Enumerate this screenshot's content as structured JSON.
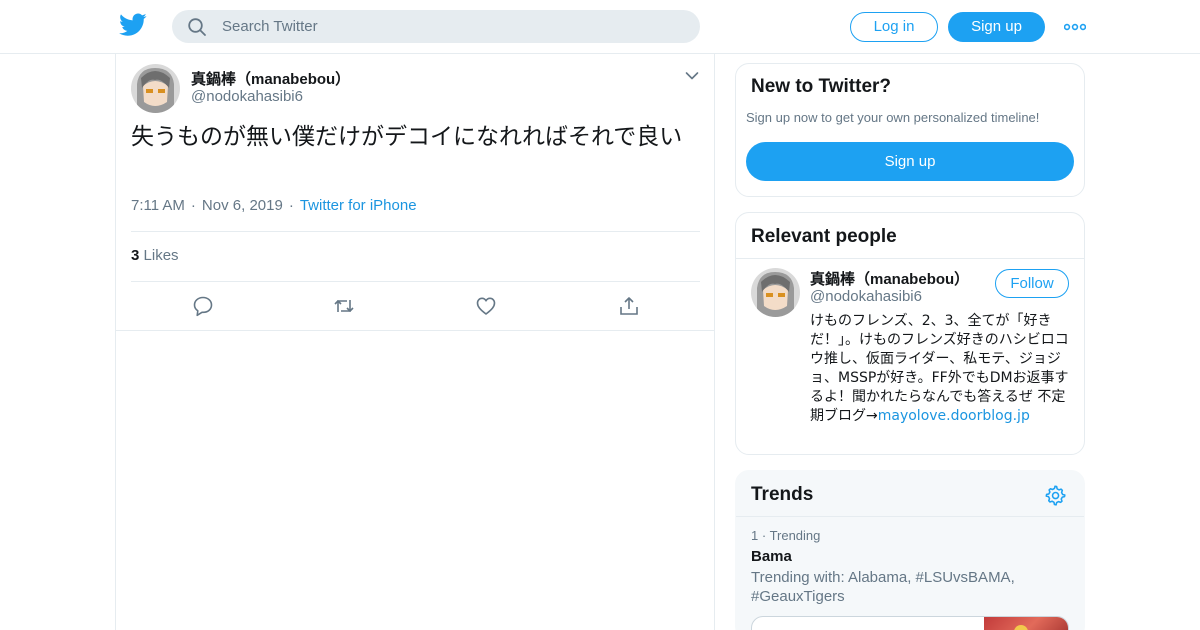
{
  "header": {
    "search_placeholder": "Search Twitter",
    "login_label": "Log in",
    "signup_label": "Sign up",
    "brand_color": "#1da1f2"
  },
  "tweet": {
    "author_name": "真鍋棒（manabebou）",
    "author_handle": "@nodokahasibi6",
    "text": "失うものが無い僕だけがデコイになれればそれで良い",
    "time": "7:11 AM",
    "date": "Nov 6, 2019",
    "source": "Twitter for iPhone",
    "likes_count": "3",
    "likes_label": "Likes",
    "actions": [
      "reply-icon",
      "retweet-icon",
      "like-icon",
      "share-icon"
    ]
  },
  "new_to_twitter": {
    "title": "New to Twitter?",
    "subtitle": "Sign up now to get your own personalized timeline!",
    "button_label": "Sign up"
  },
  "relevant_people": {
    "title": "Relevant people",
    "name": "真鍋棒（manabebou）",
    "handle": "@nodokahasibi6",
    "follow_label": "Follow",
    "bio": "けものフレンズ、2、3、全てが「好きだ！」。けものフレンズ好きのハシビロコウ推し、仮面ライダー、私モテ、ジョジョ、MSSPが好き。FF外でもDMお返事するよ！聞かれたらなんでも答えるぜ 不定期ブログ→",
    "bio_link": "mayolove.doorblog.jp"
  },
  "trends": {
    "title": "Trends",
    "items": [
      {
        "rank": "1",
        "label": "Trending",
        "name": "Bama",
        "with": "Trending with: Alabama, #LSUvsBAMA, #GeauxTigers"
      }
    ]
  }
}
